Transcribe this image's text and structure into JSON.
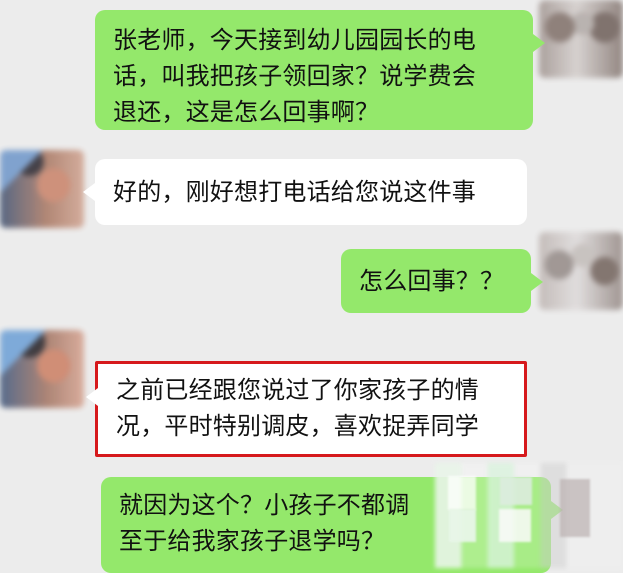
{
  "colors": {
    "background": "#ececec",
    "green_bubble": "#94e86b",
    "white_bubble": "#ffffff",
    "highlight_border": "#d6191c"
  },
  "messages": [
    {
      "lines": [
        "张老师，今天接到幼儿园园长的电",
        "话，叫我把孩子领回家？说学费会",
        "退还，这是怎么回事啊？"
      ]
    },
    {
      "lines": [
        "好的，刚好想打电话给您说这件事"
      ]
    },
    {
      "lines": [
        "怎么回事？？"
      ]
    },
    {
      "lines": [
        "之前已经跟您说过了你家孩子的情",
        "况，平时特别调皮，喜欢捉弄同学"
      ]
    },
    {
      "lines": [
        "就因为这个？小孩子不都调",
        "至于给我家孩子退学吗？"
      ]
    }
  ]
}
